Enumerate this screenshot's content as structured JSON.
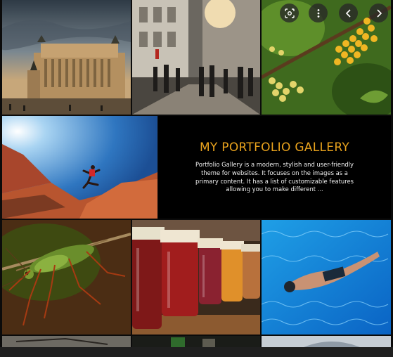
{
  "gallery": {
    "title": "MY PORTFOLIO GALLERY",
    "description": "Portfolio Gallery is a modern, stylish and user-friendly theme for websites. It focuses on the images as a primary content. It has a list of customizable features allowing you to make different ...",
    "accent_color": "#e8a21d"
  },
  "toolbar": {
    "lens_icon": "google-lens-icon",
    "more_icon": "more-vert-icon",
    "prev_icon": "chevron-left-icon",
    "next_icon": "chevron-right-icon"
  },
  "tiles": [
    {
      "subject": "vittoriano-monument-rome"
    },
    {
      "subject": "city-street-crowd"
    },
    {
      "subject": "yellow-berries-branch"
    },
    {
      "subject": "man-jumping-red-rocks"
    },
    {
      "subject": "green-grasshopper"
    },
    {
      "subject": "jam-jars-shelf"
    },
    {
      "subject": "swimmer-pool"
    }
  ]
}
